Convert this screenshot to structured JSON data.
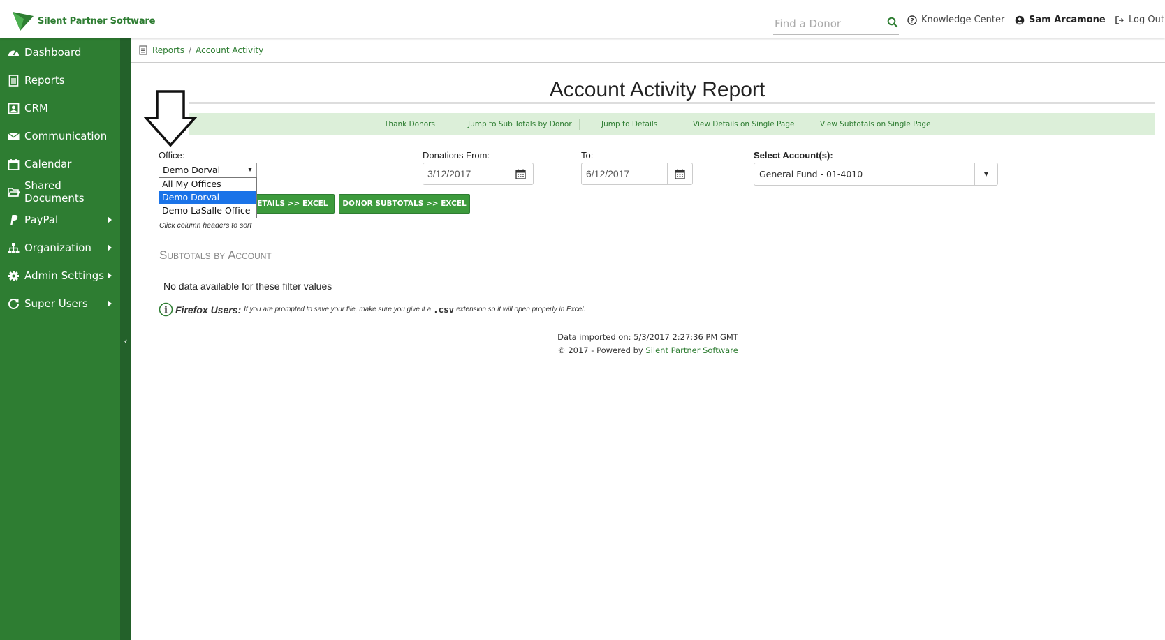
{
  "header": {
    "brand": "Silent Partner Software",
    "search_placeholder": "Find a Donor",
    "knowledge_center": "Knowledge Center",
    "user_name": "Sam Arcamone",
    "logout": "Log Out"
  },
  "sidebar": {
    "items": [
      {
        "label": "Dashboard",
        "icon": "dashboard-icon"
      },
      {
        "label": "Reports",
        "icon": "reports-icon"
      },
      {
        "label": "CRM",
        "icon": "crm-icon"
      },
      {
        "label": "Communication",
        "icon": "envelope-icon"
      },
      {
        "label": "Calendar",
        "icon": "calendar-icon"
      },
      {
        "label": "Shared Documents",
        "icon": "folder-icon"
      },
      {
        "label": "PayPal",
        "icon": "paypal-icon"
      },
      {
        "label": "Organization",
        "icon": "sitemap-icon"
      },
      {
        "label": "Admin Settings",
        "icon": "gear-icon"
      },
      {
        "label": "Super Users",
        "icon": "refresh-icon"
      }
    ]
  },
  "breadcrumb": {
    "parent": "Reports",
    "separator": "/",
    "current": "Account Activity"
  },
  "page": {
    "title": "Account Activity Report"
  },
  "jump_nav": [
    "Thank Donors",
    "Jump to Sub Totals by Donor",
    "Jump to Details",
    "View Details on Single Page",
    "View Subtotals on Single Page"
  ],
  "filters": {
    "office_label": "Office:",
    "office_value": "Demo Dorval",
    "office_options": [
      "All My Offices",
      "Demo Dorval",
      "Demo LaSalle Office"
    ],
    "donations_from_label": "Donations From:",
    "donations_from_value": "3/12/2017",
    "to_label": "To:",
    "to_value": "6/12/2017",
    "accounts_label": "Select Account(s):",
    "accounts_value": "General Fund - 01-4010"
  },
  "buttons": {
    "details_excel": "DETAILS >> EXCEL",
    "donor_subtotals_excel": "DONOR SUBTOTALS >> EXCEL"
  },
  "hint": "Click column headers to sort",
  "subtotals": {
    "heading": "Subtotals by Account",
    "empty_message": "No data available for these filter values"
  },
  "firefox_note": {
    "bold": "Firefox Users:",
    "text_before": "If you are prompted to save your file, make sure you give it a",
    "ext": ".csv",
    "text_after": "extension so it will open properly in Excel."
  },
  "footer": {
    "imported": "Data imported on: 5/3/2017 2:27:36 PM GMT",
    "powered_prefix": "© 2017 - Powered by",
    "powered_link": "Silent Partner Software"
  },
  "colors": {
    "sidebar": "#2e7d32",
    "accent": "#3c9a3c",
    "jump_nav_bg": "#dcefd9",
    "selected_option": "#1a73e8"
  }
}
